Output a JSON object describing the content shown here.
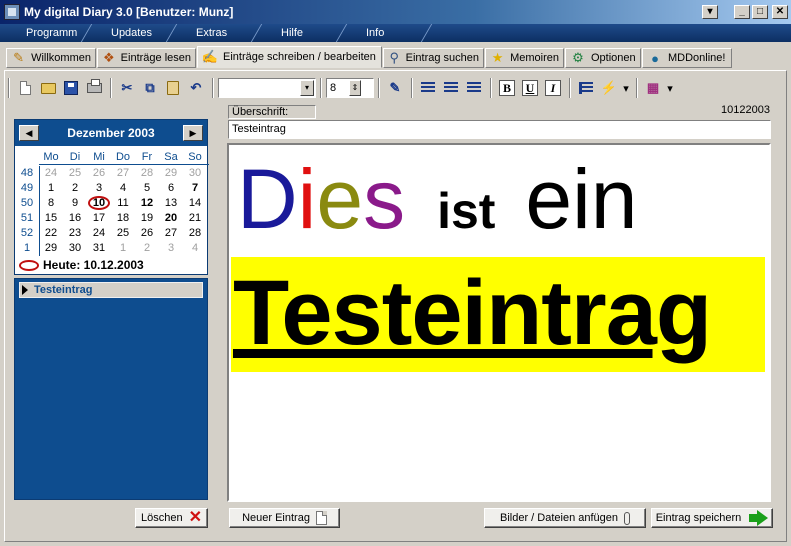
{
  "window": {
    "title": "My digital Diary 3.0   [Benutzer: Munz]",
    "menu_glyph": "▾",
    "minimize_glyph": "_",
    "maximize_glyph": "□",
    "close_glyph": "✕"
  },
  "menubar": {
    "items": [
      "Programm",
      "Updates",
      "Extras",
      "Hilfe",
      "Info"
    ]
  },
  "tabs": [
    {
      "label": "Willkommen",
      "icon": "wand-icon",
      "glyph": "✎",
      "color": "#b87a10"
    },
    {
      "label": "Einträge lesen",
      "icon": "book-icon",
      "glyph": "❖",
      "color": "#b05010"
    },
    {
      "label": "Einträge schreiben / bearbeiten",
      "icon": "pen-icon",
      "glyph": "✍",
      "color": "#3050a0",
      "active": true
    },
    {
      "label": "Eintrag suchen",
      "icon": "magnifier-icon",
      "glyph": "⚲",
      "color": "#305080"
    },
    {
      "label": "Memoiren",
      "icon": "star-icon",
      "glyph": "★",
      "color": "#e0b000"
    },
    {
      "label": "Optionen",
      "icon": "gears-icon",
      "glyph": "⚙",
      "color": "#208040"
    },
    {
      "label": "MDDonline!",
      "icon": "globe-icon",
      "glyph": "●",
      "color": "#1a6a9a"
    }
  ],
  "toolbar": {
    "font_value": "",
    "size_value": "8",
    "cut_glyph": "✂",
    "copy_glyph": "⧉",
    "paste_glyph": "📋",
    "undo_glyph": "↶",
    "spell_glyph": "✎",
    "bold_label": "B",
    "underline_label": "U",
    "italic_label": "I",
    "lightning_glyph": "⚡",
    "color_glyph": "▦",
    "dropdown_glyph": "▾",
    "spinner_glyph": "⇕"
  },
  "calendar": {
    "title": "Dezember 2003",
    "prev_glyph": "◀",
    "next_glyph": "▶",
    "weekday_labels": [
      "Mo",
      "Di",
      "Mi",
      "Do",
      "Fr",
      "Sa",
      "So"
    ],
    "weeks": [
      {
        "wk": "48",
        "days": [
          "24",
          "25",
          "26",
          "27",
          "28",
          "29",
          "30"
        ],
        "gray": [
          0,
          1,
          2,
          3,
          4,
          5,
          6
        ],
        "bold": []
      },
      {
        "wk": "49",
        "days": [
          "1",
          "2",
          "3",
          "4",
          "5",
          "6",
          "7"
        ],
        "gray": [],
        "bold": [
          6
        ]
      },
      {
        "wk": "50",
        "days": [
          "8",
          "9",
          "10",
          "11",
          "12",
          "13",
          "14"
        ],
        "gray": [],
        "bold": [
          4
        ],
        "today": 2
      },
      {
        "wk": "51",
        "days": [
          "15",
          "16",
          "17",
          "18",
          "19",
          "20",
          "21"
        ],
        "gray": [],
        "bold": [
          5
        ]
      },
      {
        "wk": "52",
        "days": [
          "22",
          "23",
          "24",
          "25",
          "26",
          "27",
          "28"
        ],
        "gray": [],
        "bold": []
      },
      {
        "wk": "1",
        "days": [
          "29",
          "30",
          "31",
          "1",
          "2",
          "3",
          "4"
        ],
        "gray": [
          3,
          4,
          5,
          6
        ],
        "bold": []
      }
    ],
    "today_label": "Heute: 10.12.2003"
  },
  "entries": {
    "items": [
      "Testeintrag"
    ]
  },
  "editor": {
    "heading_label": "Überschrift:",
    "heading_value": "Testeintrag",
    "date_code": "10122003",
    "line1": [
      {
        "text": "D",
        "color": "#1a1a9a",
        "size": "big"
      },
      {
        "text": "i",
        "color": "#e01010",
        "size": "big"
      },
      {
        "text": "e",
        "color": "#8a8a10",
        "size": "big"
      },
      {
        "text": "s",
        "color": "#8a1a8a",
        "size": "big"
      },
      {
        "text": "ist",
        "color": "#000000",
        "size": "mid"
      },
      {
        "text": "ein",
        "color": "#000000",
        "size": "big"
      }
    ],
    "line2": "Testeintrag",
    "highlight_color": "#ffff00"
  },
  "buttons": {
    "delete": "Löschen",
    "new_entry": "Neuer Eintrag",
    "attach": "Bilder / Dateien anfügen",
    "save": "Eintrag speichern"
  }
}
